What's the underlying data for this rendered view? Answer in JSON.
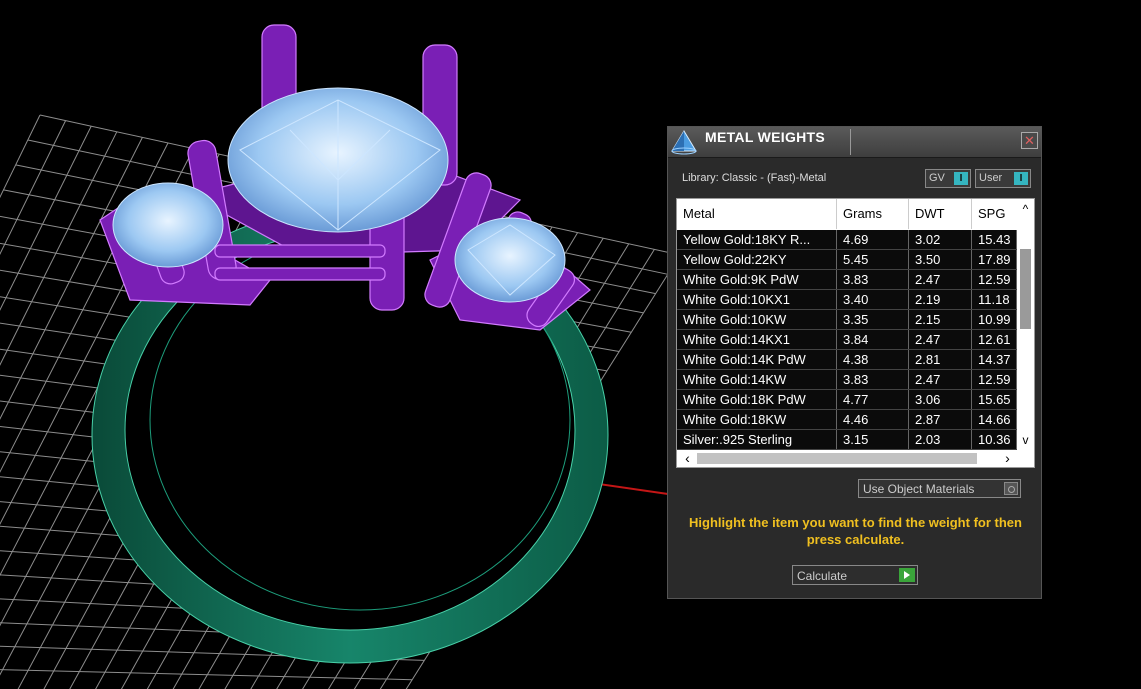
{
  "panel": {
    "title": "METAL WEIGHTS",
    "library_label": "Library: Classic - (Fast)-Metal",
    "toggles": [
      {
        "label": "GV",
        "indicator": "I"
      },
      {
        "label": "User",
        "indicator": "I"
      }
    ],
    "table": {
      "columns": [
        "Metal",
        "Grams",
        "DWT",
        "SPG"
      ],
      "rows": [
        [
          "Yellow Gold:18KY R...",
          "4.69",
          "3.02",
          "15.43"
        ],
        [
          "Yellow Gold:22KY",
          "5.45",
          "3.50",
          "17.89"
        ],
        [
          "White Gold:9K PdW",
          "3.83",
          "2.47",
          "12.59"
        ],
        [
          "White Gold:10KX1",
          "3.40",
          "2.19",
          "11.18"
        ],
        [
          "White Gold:10KW",
          "3.35",
          "2.15",
          "10.99"
        ],
        [
          "White Gold:14KX1",
          "3.84",
          "2.47",
          "12.61"
        ],
        [
          "White Gold:14K PdW",
          "4.38",
          "2.81",
          "14.37"
        ],
        [
          "White Gold:14KW",
          "3.83",
          "2.47",
          "12.59"
        ],
        [
          "White Gold:18K PdW",
          "4.77",
          "3.06",
          "15.65"
        ],
        [
          "White Gold:18KW",
          "4.46",
          "2.87",
          "14.66"
        ],
        [
          "Silver:.925 Sterling",
          "3.15",
          "2.03",
          "10.36"
        ]
      ]
    },
    "use_object_materials_label": "Use Object Materials",
    "hint": "Highlight the item you want to find the weight for then press calculate.",
    "calculate_label": "Calculate"
  }
}
